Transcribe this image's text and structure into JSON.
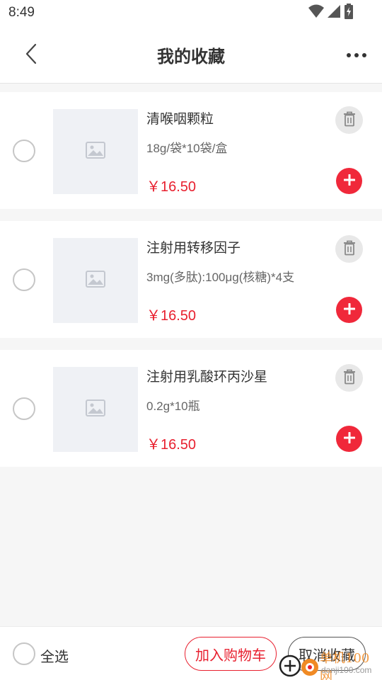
{
  "status_bar": {
    "time": "8:49",
    "icons": [
      "wifi-icon",
      "cell-signal-icon",
      "battery-charging-icon"
    ]
  },
  "nav": {
    "title": "我的收藏",
    "back_icon": "chevron-left-icon",
    "more_icon": "more-dots-icon"
  },
  "items": [
    {
      "name": "清喉咽颗粒",
      "spec": "18g/袋*10袋/盒",
      "price": "￥16.50",
      "selected": false
    },
    {
      "name": "注射用转移因子",
      "spec": "3mg(多肽):100μg(核糖)*4支",
      "price": "￥16.50",
      "selected": false
    },
    {
      "name": "注射用乳酸环丙沙星",
      "spec": "0.2g*10瓶",
      "price": "￥16.50",
      "selected": false
    }
  ],
  "bottom_bar": {
    "select_all_label": "全选",
    "add_to_cart_label": "加入购物车",
    "cancel_favorite_label": "取消收藏"
  },
  "watermark": {
    "line1": "单机100网",
    "line2": "danji100.com"
  },
  "colors": {
    "accent_red": "#f0283a",
    "price_red": "#e8202f",
    "thumb_bg": "#eff1f5",
    "page_bg": "#f6f6f6"
  }
}
